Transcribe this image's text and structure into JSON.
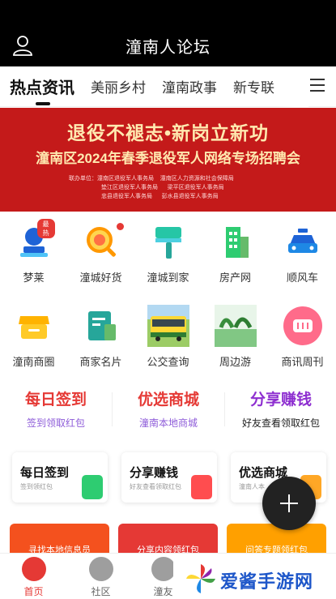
{
  "header": {
    "title": "潼南人论坛"
  },
  "tabs": [
    {
      "label": "热点资讯",
      "active": true
    },
    {
      "label": "美丽乡村"
    },
    {
      "label": "潼南政事"
    },
    {
      "label": "新专联"
    }
  ],
  "banner": {
    "title": "退役不褪志•新岗立新功",
    "subtitle": "潼南区2024年春季退役军人网络专场招聘会",
    "orgs_left": [
      "联办单位：潼南区退役军人事务局",
      "垫江区退役军人事务局",
      "忠县退役军人事务局"
    ],
    "orgs_right": [
      "潼南区人力资源和社会保障局",
      "梁平区退役军人事务局",
      "彭水县退役军人事务局"
    ]
  },
  "grid": [
    {
      "label": "梦莱",
      "icon": "person-stamp-icon",
      "badge": "最热"
    },
    {
      "label": "潼城好货",
      "icon": "magnifier-icon",
      "dot": true
    },
    {
      "label": "潼城到家",
      "icon": "paint-roller-icon"
    },
    {
      "label": "房产网",
      "icon": "building-icon"
    },
    {
      "label": "顺风车",
      "icon": "taxi-icon"
    },
    {
      "label": "潼南商圈",
      "icon": "shop-icon"
    },
    {
      "label": "商家名片",
      "icon": "card-icon"
    },
    {
      "label": "公交查询",
      "icon": "bus-photo"
    },
    {
      "label": "周边游",
      "icon": "travel-photo"
    },
    {
      "label": "商讯周刊",
      "icon": "magazine-icon"
    }
  ],
  "promo": [
    {
      "title": "每日签到",
      "subtitle": "签到领取红包",
      "color": "#e53935",
      "sub_color": "#8e5cd9"
    },
    {
      "title": "优选商城",
      "subtitle": "潼南本地商城",
      "color": "#e53935",
      "sub_color": "#8e5cd9"
    },
    {
      "title": "分享赚钱",
      "subtitle": "好友查看领取红包",
      "color": "#8e2fd0",
      "sub_color": "#222222"
    }
  ],
  "cards": [
    {
      "title": "每日签到",
      "subtitle": "签到领红包",
      "icon_color": "#2ecc71"
    },
    {
      "title": "分享赚钱",
      "subtitle": "好友查看领取红包",
      "icon_color": "#ff4d4f"
    },
    {
      "title": "优选商城",
      "subtitle": "潼南人本",
      "icon_color": "#ffa726"
    }
  ],
  "ads": [
    {
      "text": "寻找本地信息员",
      "color": "#f4511e"
    },
    {
      "text": "分享内容领红包",
      "color": "#e53935"
    },
    {
      "text": "问答专题领红包",
      "color": "#ffa000"
    }
  ],
  "bottom_nav": [
    {
      "label": "首页",
      "active": true
    },
    {
      "label": "社区"
    },
    {
      "label": "潼友"
    }
  ],
  "watermark": {
    "text": "爱酱手游网"
  }
}
